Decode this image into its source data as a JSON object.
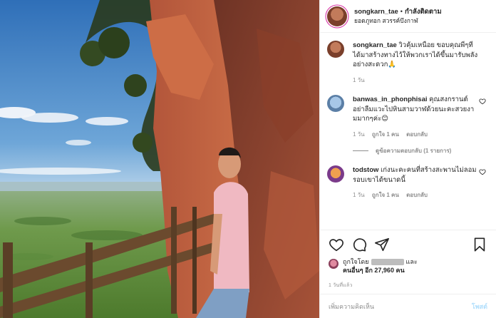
{
  "header": {
    "username": "songkarn_tae",
    "separator": "•",
    "follow_label": "กำลังติดตาม",
    "location": "ยอดภูทอก สวรรค์บึงกาฬ"
  },
  "caption": {
    "username": "songkarn_tae",
    "text": "วิวคุ้มเหนื่อย ขอบคุณพี่ๆที่ได้มาสร้างทางไว้ให้พวกเราได้ขึ้นมารับพลังอย่างสะดวก🙏",
    "time": "1 วัน"
  },
  "comments": [
    {
      "username": "banwas_in_phonphisai",
      "text": "คุณสงกรานต์อย่าลืมแวะไปหินสามวาฬด้วยนะคะสวยงามมากๆค่ะ😊",
      "time": "1 วัน",
      "likes": "ถูกใจ 1 คน",
      "reply_label": "ตอบกลับ",
      "view_replies": "ดูข้อความตอบกลับ (1 รายการ)"
    },
    {
      "username": "todstow",
      "text": "เก่งนะคะคนที่สร้างสะพานไม่ลอมรอบเขาได้ขนาดนี้",
      "time": "1 วัน",
      "likes": "ถูกใจ 1 คน",
      "reply_label": "ตอบกลับ"
    }
  ],
  "likes": {
    "prefix": "ถูกใจโดย",
    "and": "และ",
    "others": "คนอื่นๆ อีก 27,960 คน"
  },
  "post_date": "1 วันที่แล้ว",
  "add_comment": {
    "placeholder": "เพิ่มความคิดเห็น",
    "post_label": "โพสต์"
  },
  "icons": [
    "heart-icon",
    "comment-icon",
    "share-icon",
    "bookmark-icon",
    "heart-small-icon"
  ],
  "colors": {
    "follow_ring": "#d6249f",
    "muted": "#8e8e8e",
    "post_disabled": "#b2dffc"
  }
}
